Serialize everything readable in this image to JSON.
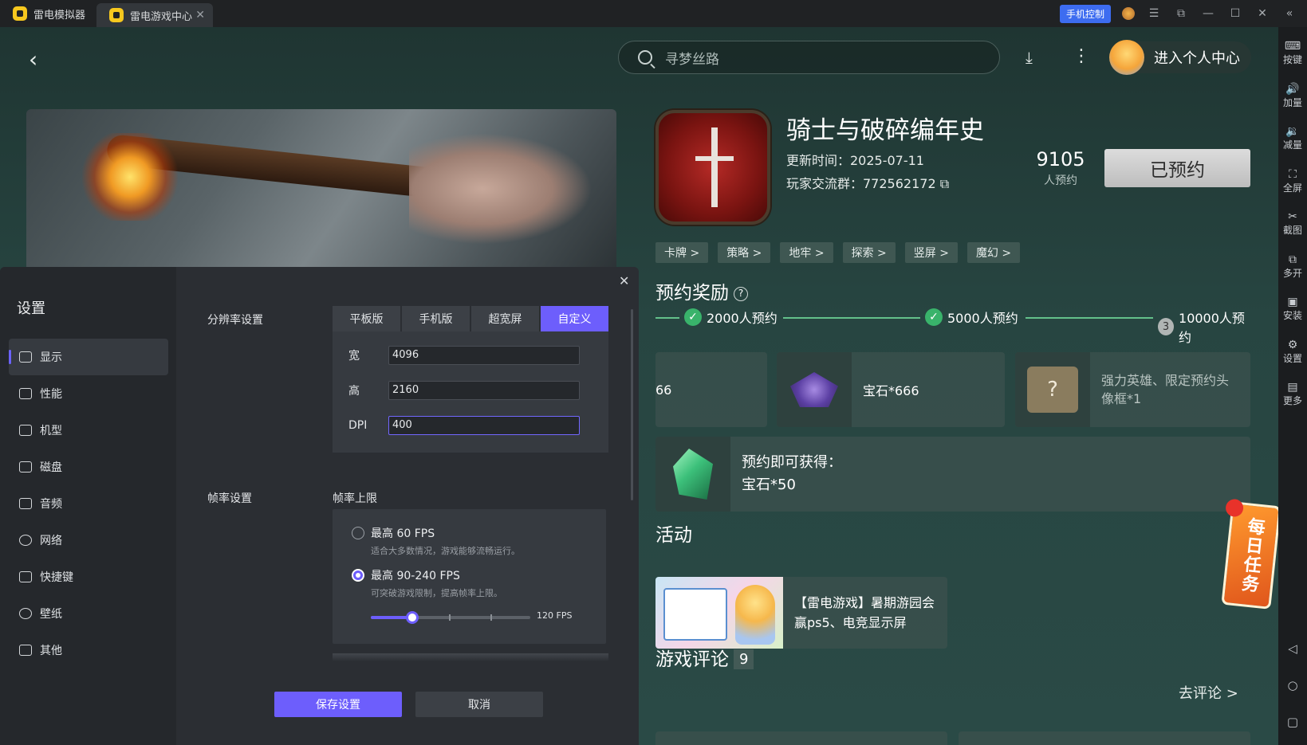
{
  "titlebar": {
    "tabs": [
      {
        "label": "雷电模拟器"
      },
      {
        "label": "雷电游戏中心"
      }
    ],
    "phone_control": "手机控制",
    "icons": [
      "avatar-icon",
      "menu-icon",
      "restore-icon",
      "minimize-icon",
      "maximize-icon",
      "close-icon",
      "collapse-icon"
    ]
  },
  "right_sidebar": {
    "items": [
      {
        "label": "按键",
        "icon": "keyboard-icon"
      },
      {
        "label": "加量",
        "icon": "volume-up-icon"
      },
      {
        "label": "减量",
        "icon": "volume-down-icon"
      },
      {
        "label": "全屏",
        "icon": "fullscreen-icon"
      },
      {
        "label": "截图",
        "icon": "scissors-icon"
      },
      {
        "label": "多开",
        "icon": "multi-instance-icon"
      },
      {
        "label": "安装",
        "icon": "apk-icon"
      },
      {
        "label": "设置",
        "icon": "gear-icon"
      },
      {
        "label": "更多",
        "icon": "more-icon"
      }
    ]
  },
  "header": {
    "search_placeholder": "寻梦丝路",
    "personal_center": "进入个人中心"
  },
  "game": {
    "title": "骑士与破碎编年史",
    "update_time": "更新时间：2025-07-11",
    "player_group": "玩家交流群：772562172",
    "reserve_count": "9105",
    "reserve_label": "人预约",
    "reserved_button": "已预约",
    "tags": [
      "卡牌 >",
      "策略 >",
      "地牢 >",
      "探索 >",
      "竖屏 >",
      "魔幻 >"
    ]
  },
  "rewards": {
    "title": "预约奖励",
    "milestones": [
      "2000人预约",
      "5000人预约",
      "10000人预约"
    ],
    "milestone_3_num": "3",
    "items": [
      {
        "label": "66"
      },
      {
        "label": "宝石*666"
      },
      {
        "label": "强力英雄、限定预约头像框*1"
      }
    ],
    "immediate_title": "预约即可获得：",
    "immediate_value": "宝石*50"
  },
  "daily_task": "每日任务",
  "activity": {
    "title": "活动",
    "item": "【雷电游戏】暑期游园会赢ps5、电竞显示屏"
  },
  "comments": {
    "title": "游戏评论",
    "count": "9",
    "go": "去评论 >"
  },
  "settings": {
    "title": "设置",
    "nav": [
      {
        "label": "显示",
        "active": true
      },
      {
        "label": "性能"
      },
      {
        "label": "机型"
      },
      {
        "label": "磁盘"
      },
      {
        "label": "音频"
      },
      {
        "label": "网络"
      },
      {
        "label": "快捷键"
      },
      {
        "label": "壁纸"
      },
      {
        "label": "其他"
      }
    ],
    "resolution_label": "分辨率设置",
    "resolution_tabs": [
      "平板版",
      "手机版",
      "超宽屏",
      "自定义"
    ],
    "width_label": "宽",
    "width_value": "4096",
    "height_label": "高",
    "height_value": "2160",
    "dpi_label": "DPI",
    "dpi_value": "400",
    "fps_label": "帧率设置",
    "fps_limit_label": "帧率上限",
    "fps_options": [
      {
        "label": "最高 60 FPS",
        "desc": "适合大多数情况，游戏能够流畅运行。",
        "selected": false
      },
      {
        "label": "最高 90-240 FPS",
        "desc": "可突破游戏限制，提高帧率上限。",
        "selected": true
      }
    ],
    "fps_slider_fraction": 0.26,
    "fps_value": "120 FPS",
    "save": "保存设置",
    "cancel": "取消"
  },
  "colors": {
    "accent": "#6d5efc",
    "success": "#39b36b",
    "phone_control": "#3d6cf0"
  }
}
